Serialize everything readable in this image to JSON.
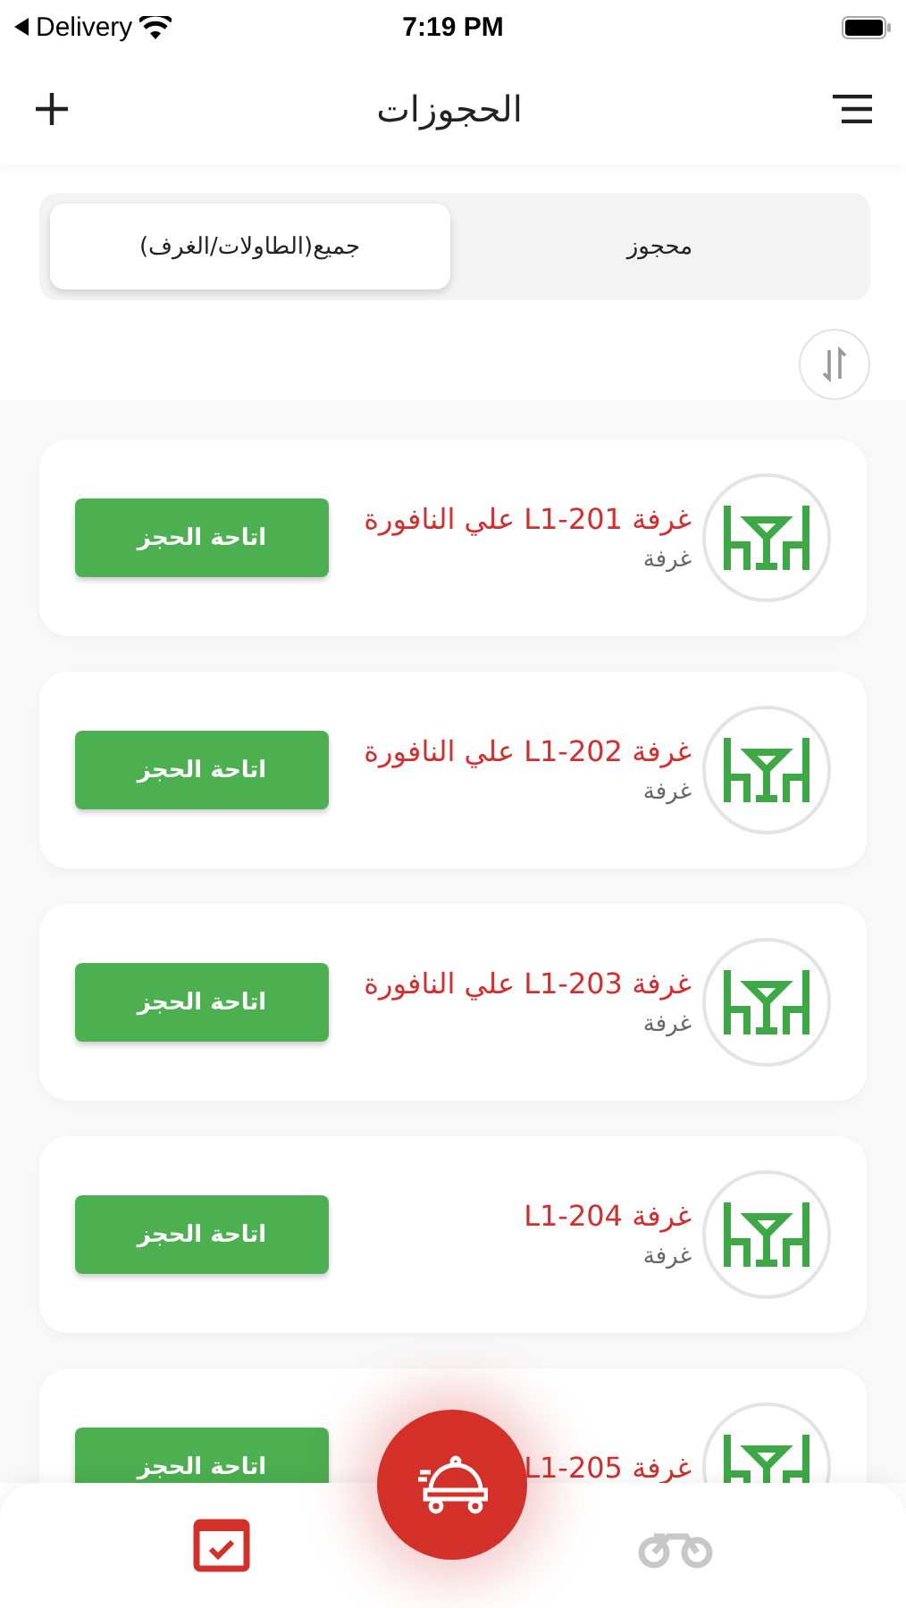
{
  "status_bar": {
    "back_app": "Delivery",
    "time": "7:19 PM"
  },
  "header": {
    "title": "الحجوزات"
  },
  "tabs": [
    {
      "label": "محجوز",
      "selected": false
    },
    {
      "label": "جميع(الطاولات/الغرف)",
      "selected": true
    }
  ],
  "rooms": [
    {
      "title": "غرفة L1-201 علي النافورة",
      "subtitle": "غرفة",
      "action": "اتاحة الحجز"
    },
    {
      "title": "غرفة L1-202 علي النافورة",
      "subtitle": "غرفة",
      "action": "اتاحة الحجز"
    },
    {
      "title": "غرفة L1-203 علي النافورة",
      "subtitle": "غرفة",
      "action": "اتاحة الحجز"
    },
    {
      "title": "غرفة L1-204",
      "subtitle": "غرفة",
      "action": "اتاحة الحجز"
    },
    {
      "title": "غرفة L1-205",
      "action": "اتاحة الحجز"
    }
  ],
  "bottom_nav": [
    {
      "kind": "bookings",
      "selected": true
    },
    {
      "kind": "delivery",
      "selected": false
    }
  ]
}
